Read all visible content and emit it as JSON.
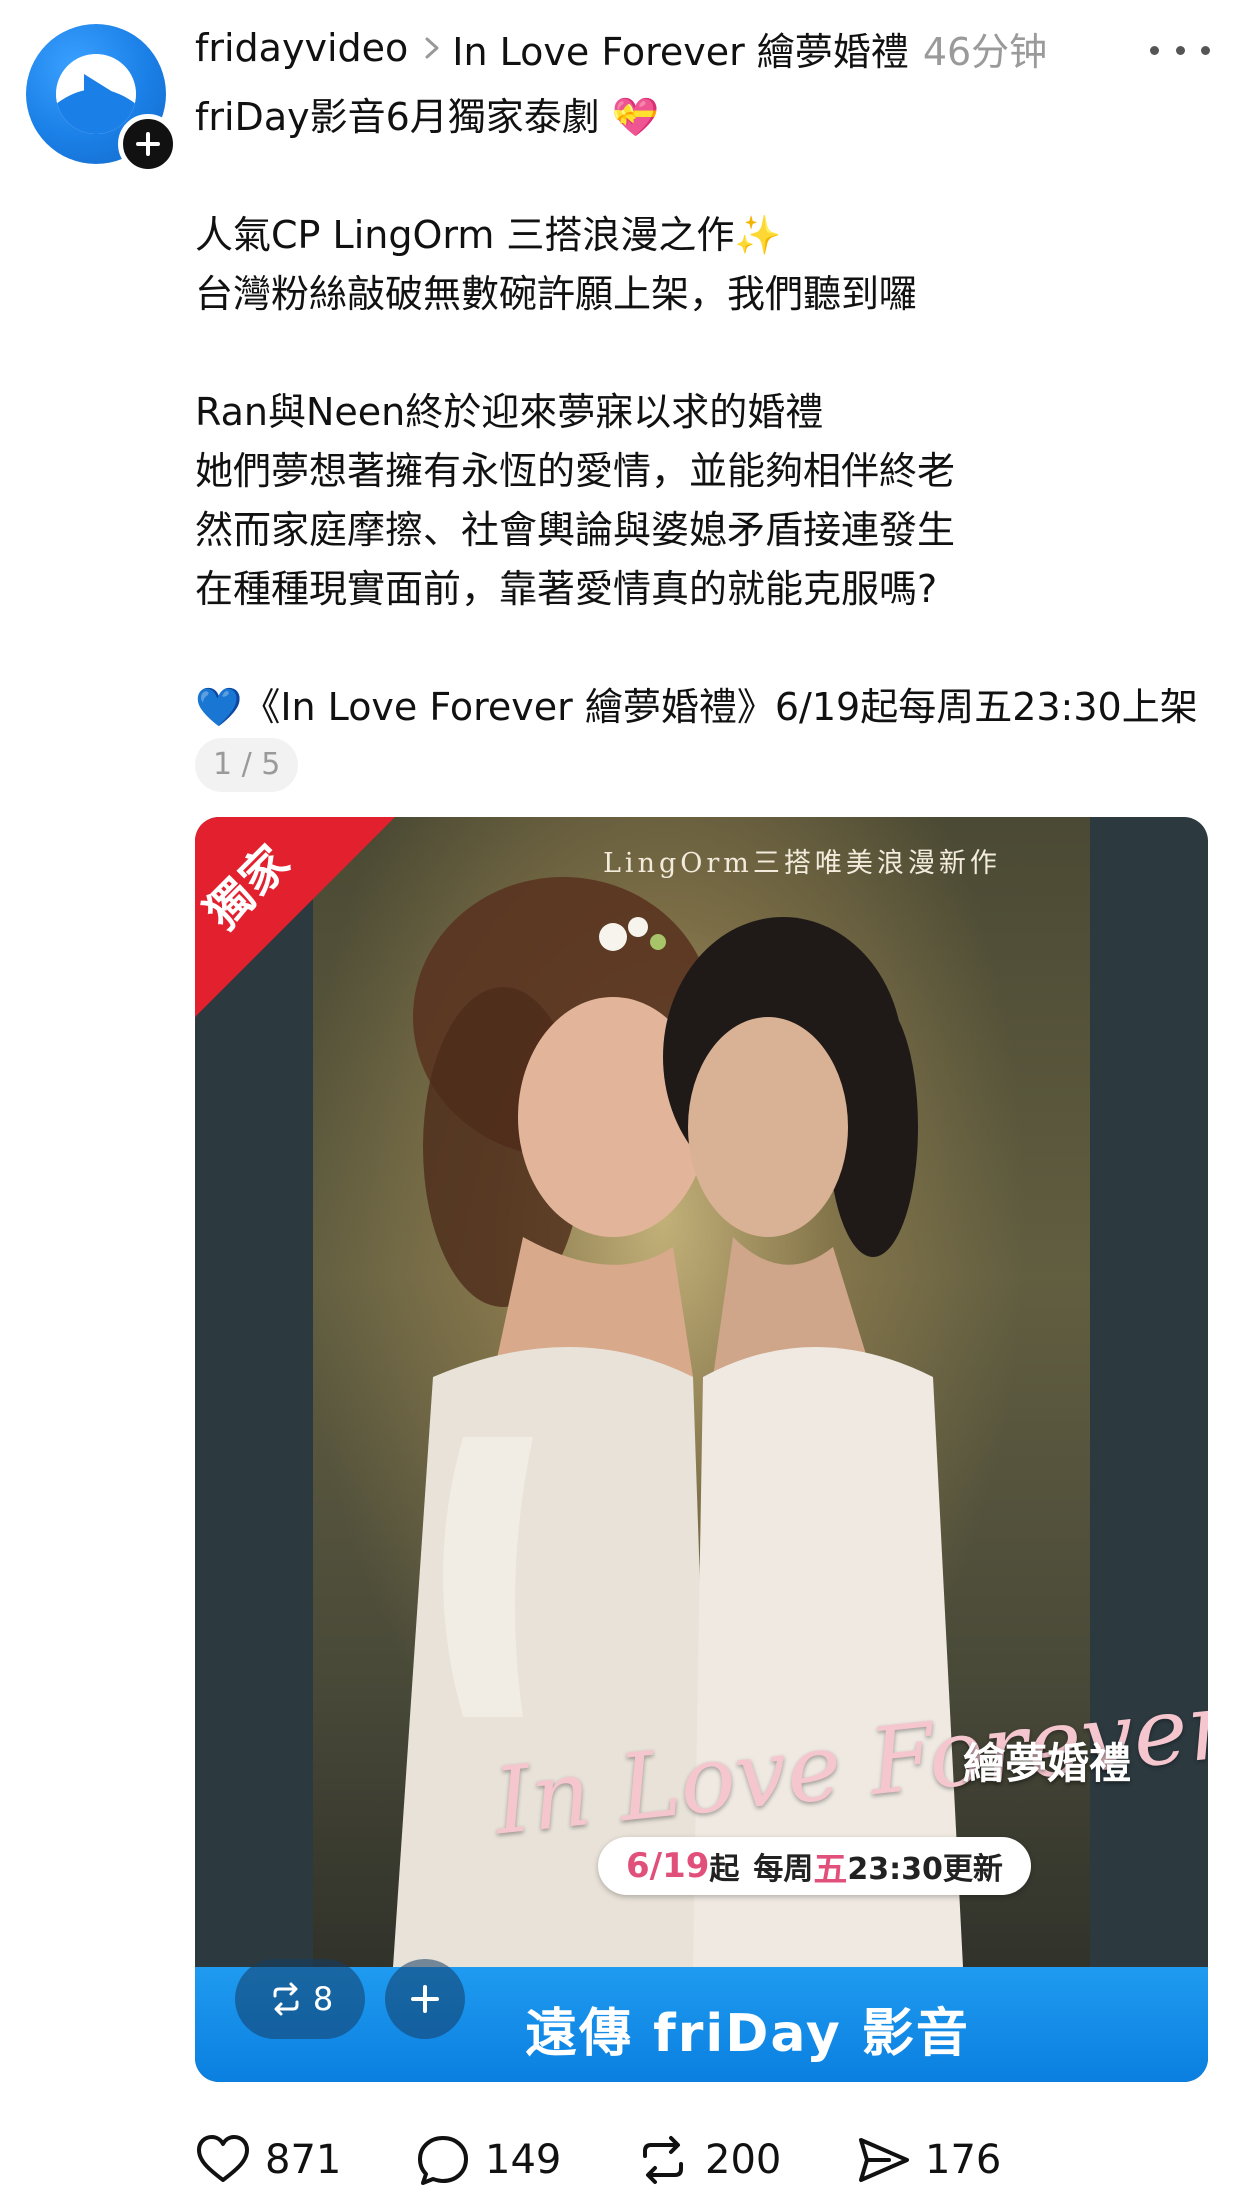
{
  "post": {
    "username": "fridayvideo",
    "topic": "In Love Forever 繪夢婚禮",
    "time": "46分钟",
    "lines": [
      "friDay影音6月獨家泰劇 💝",
      "",
      "人氣CP LingOrm 三搭浪漫之作✨",
      "台灣粉絲敲破無數碗許願上架，我們聽到囉",
      "",
      "Ran與Neen終於迎來夢寐以求的婚禮",
      "她們夢想著擁有永恆的愛情，並能夠相伴終老",
      "然而家庭摩擦、社會輿論與婆媳矛盾接連發生",
      "在種種現實面前，靠著愛情真的就能克服嗎?",
      "",
      "💙《In Love Forever 繪夢婚禮》6/19起每周五23:30上架"
    ],
    "page_indicator": "1 / 5"
  },
  "media": {
    "exclusive_label": "獨家",
    "tagline": "LingOrm三搭唯美浪漫新作",
    "script_title": "In Love Forever",
    "cn_title": "繪夢婚禮",
    "air_date": "6/19",
    "air_from": "起",
    "air_weekly_prefix": "每周",
    "air_day": "五",
    "air_time_update": "23:30更新",
    "brand": "遠傳 friDay 影音",
    "repost_count": "8"
  },
  "actions": {
    "likes": "871",
    "comments": "149",
    "reposts": "200",
    "shares": "176"
  },
  "colors": {
    "brand_blue": "#0a7fe0",
    "ribbon_red": "#e3202e",
    "muted_text": "#9a9a9a"
  }
}
